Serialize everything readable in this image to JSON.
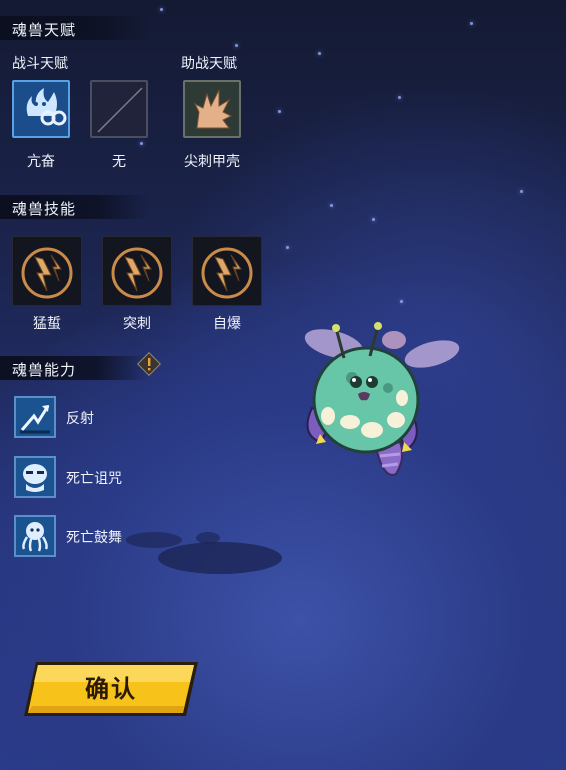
{
  "sections": {
    "talent": {
      "title": "魂兽天赋",
      "battle_label": "战斗天赋",
      "support_label": "助战天赋"
    },
    "skills": {
      "title": "魂兽技能"
    },
    "abilities": {
      "title": "魂兽能力"
    }
  },
  "talents": [
    {
      "name": "亢奋",
      "icon": "fire-spirit-icon",
      "state": "active"
    },
    {
      "name": "无",
      "icon": "empty-slot-icon",
      "state": "empty"
    },
    {
      "name": "尖刺甲壳",
      "icon": "spiked-shell-icon",
      "state": "equipped"
    }
  ],
  "skills": [
    {
      "name": "猛蜇",
      "icon": "lightning-fist-icon"
    },
    {
      "name": "突刺",
      "icon": "lightning-fist-icon"
    },
    {
      "name": "自爆",
      "icon": "lightning-fist-icon"
    }
  ],
  "abilities": [
    {
      "name": "反射",
      "icon": "reflect-arrow-icon"
    },
    {
      "name": "死亡诅咒",
      "icon": "death-curse-mask-icon"
    },
    {
      "name": "死亡鼓舞",
      "icon": "death-inspire-octopus-icon"
    }
  ],
  "confirm_button": {
    "label": "确认"
  },
  "colors": {
    "accent_blue": "#5aa2e8",
    "confirm_yellow": "#f7c21a",
    "skill_bronze": "#c98a4a"
  }
}
